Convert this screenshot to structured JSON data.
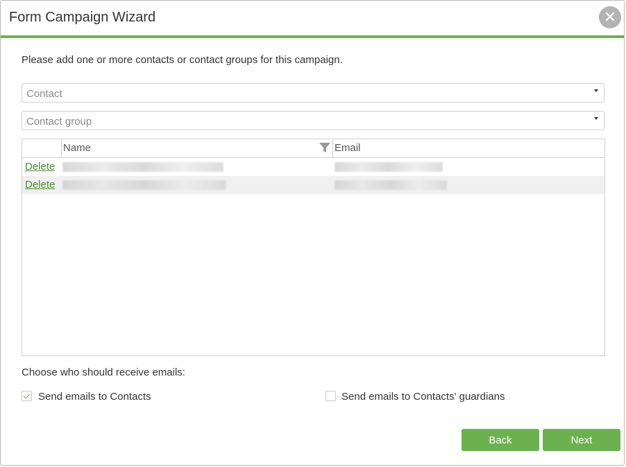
{
  "dialog": {
    "title": "Form Campaign Wizard",
    "close_glyph": "✕"
  },
  "intro": "Please add one or more contacts or contact groups for this campaign.",
  "contact_select": {
    "placeholder": "Contact"
  },
  "group_select": {
    "placeholder": "Contact group"
  },
  "grid": {
    "columns": [
      "",
      "Name",
      "Email"
    ],
    "rows": [
      {
        "action": "Delete",
        "name": "",
        "email": ""
      },
      {
        "action": "Delete",
        "name": "",
        "email": ""
      }
    ]
  },
  "recipients": {
    "label": "Choose who should receive emails:",
    "options": [
      {
        "label": "Send emails to Contacts",
        "checked": true
      },
      {
        "label": "Send emails to Contacts' guardians",
        "checked": false
      }
    ]
  },
  "buttons": {
    "back": "Back",
    "next": "Next"
  },
  "colors": {
    "accent": "#6cb14f",
    "link": "#4a8a2e"
  }
}
